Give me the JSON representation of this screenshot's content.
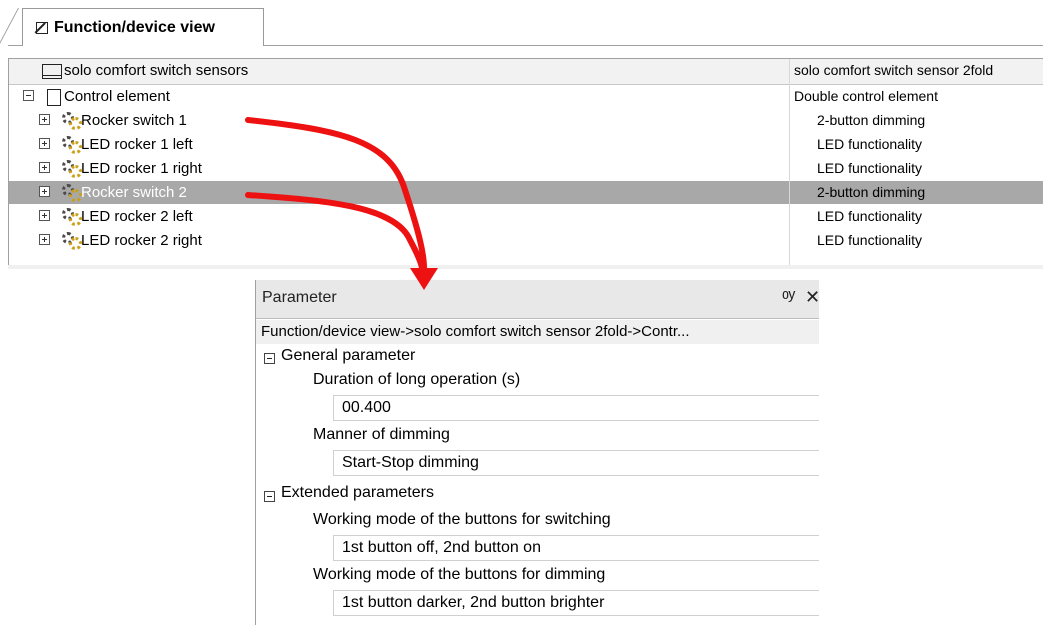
{
  "tab": {
    "label": "Function/device view"
  },
  "tree": {
    "header": {
      "label": "solo comfort switch sensors",
      "value": "solo comfort switch sensor 2fold"
    },
    "control": {
      "label": "Control element",
      "value": "Double control element"
    },
    "items": [
      {
        "label": "Rocker switch 1",
        "value": "2-button dimming",
        "selected": false
      },
      {
        "label": "LED rocker 1 left",
        "value": "LED functionality",
        "selected": false
      },
      {
        "label": "LED rocker 1 right",
        "value": "LED functionality",
        "selected": false
      },
      {
        "label": "Rocker switch 2",
        "value": "2-button dimming",
        "selected": true
      },
      {
        "label": "LED rocker 2 left",
        "value": "LED functionality",
        "selected": false
      },
      {
        "label": "LED rocker 2 right",
        "value": "LED functionality",
        "selected": false
      }
    ]
  },
  "parameter": {
    "title": "Parameter",
    "pin_glyph": "ѹ",
    "close_glyph": "✕",
    "path": "Function/device view->solo comfort switch sensor 2fold->Contr...",
    "general": {
      "label": "General parameter",
      "long_op_label": "Duration of long operation (s)",
      "long_op_value": "00.400",
      "dimming_label": "Manner of dimming",
      "dimming_value": "Start-Stop dimming"
    },
    "extended": {
      "label": "Extended parameters",
      "switching_label": "Working mode of the buttons for switching",
      "switching_value": "1st button off, 2nd button on",
      "dimming_label": "Working mode of the buttons for dimming",
      "dimming_value": "1st button darker, 2nd button brighter"
    }
  },
  "colors": {
    "arrow": "#ee1111",
    "selected_row": "#a8a8a8"
  }
}
